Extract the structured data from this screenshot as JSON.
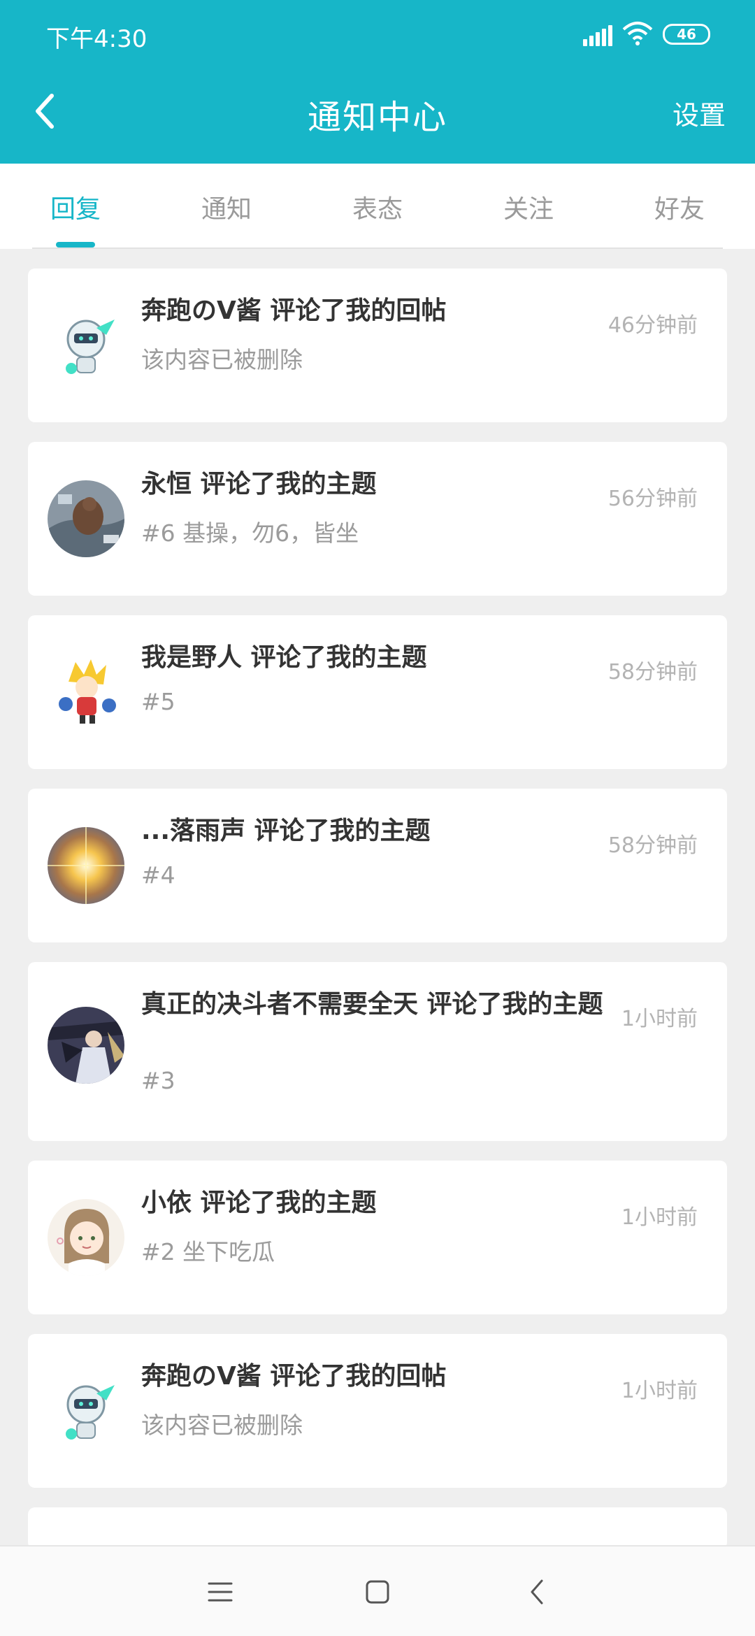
{
  "status_bar": {
    "time": "下午4:30",
    "battery": "46"
  },
  "app_bar": {
    "title": "通知中心",
    "settings_label": "设置"
  },
  "tabs": [
    {
      "label": "回复",
      "active": true
    },
    {
      "label": "通知",
      "active": false
    },
    {
      "label": "表态",
      "active": false
    },
    {
      "label": "关注",
      "active": false
    },
    {
      "label": "好友",
      "active": false
    }
  ],
  "notifications": [
    {
      "title": "奔跑のV酱 评论了我的回帖",
      "subtitle": "该内容已被删除",
      "time": "46分钟前",
      "avatar": "mecha-avatar"
    },
    {
      "title": "永恒 评论了我的主题",
      "subtitle": "#6 基操，勿6，皆坐",
      "time": "56分钟前",
      "avatar": "photo-avatar"
    },
    {
      "title": "我是野人 评论了我的主题",
      "subtitle": "#5",
      "time": "58分钟前",
      "avatar": "chibi-avatar"
    },
    {
      "title": "...落雨声 评论了我的主题",
      "subtitle": "#4",
      "time": "58分钟前",
      "avatar": "sun-avatar"
    },
    {
      "title": "真正的决斗者不需要全天 评论了我的主题",
      "subtitle": "#3",
      "time": "1小时前",
      "avatar": "knight-avatar"
    },
    {
      "title": "小依 评论了我的主题",
      "subtitle": "#2 坐下吃瓜",
      "time": "1小时前",
      "avatar": "girl-avatar"
    },
    {
      "title": "奔跑のV酱 评论了我的回帖",
      "subtitle": "该内容已被删除",
      "time": "1小时前",
      "avatar": "mecha-avatar"
    }
  ],
  "colors": {
    "accent": "#17b6c8",
    "background": "#efefef",
    "card": "#ffffff"
  }
}
